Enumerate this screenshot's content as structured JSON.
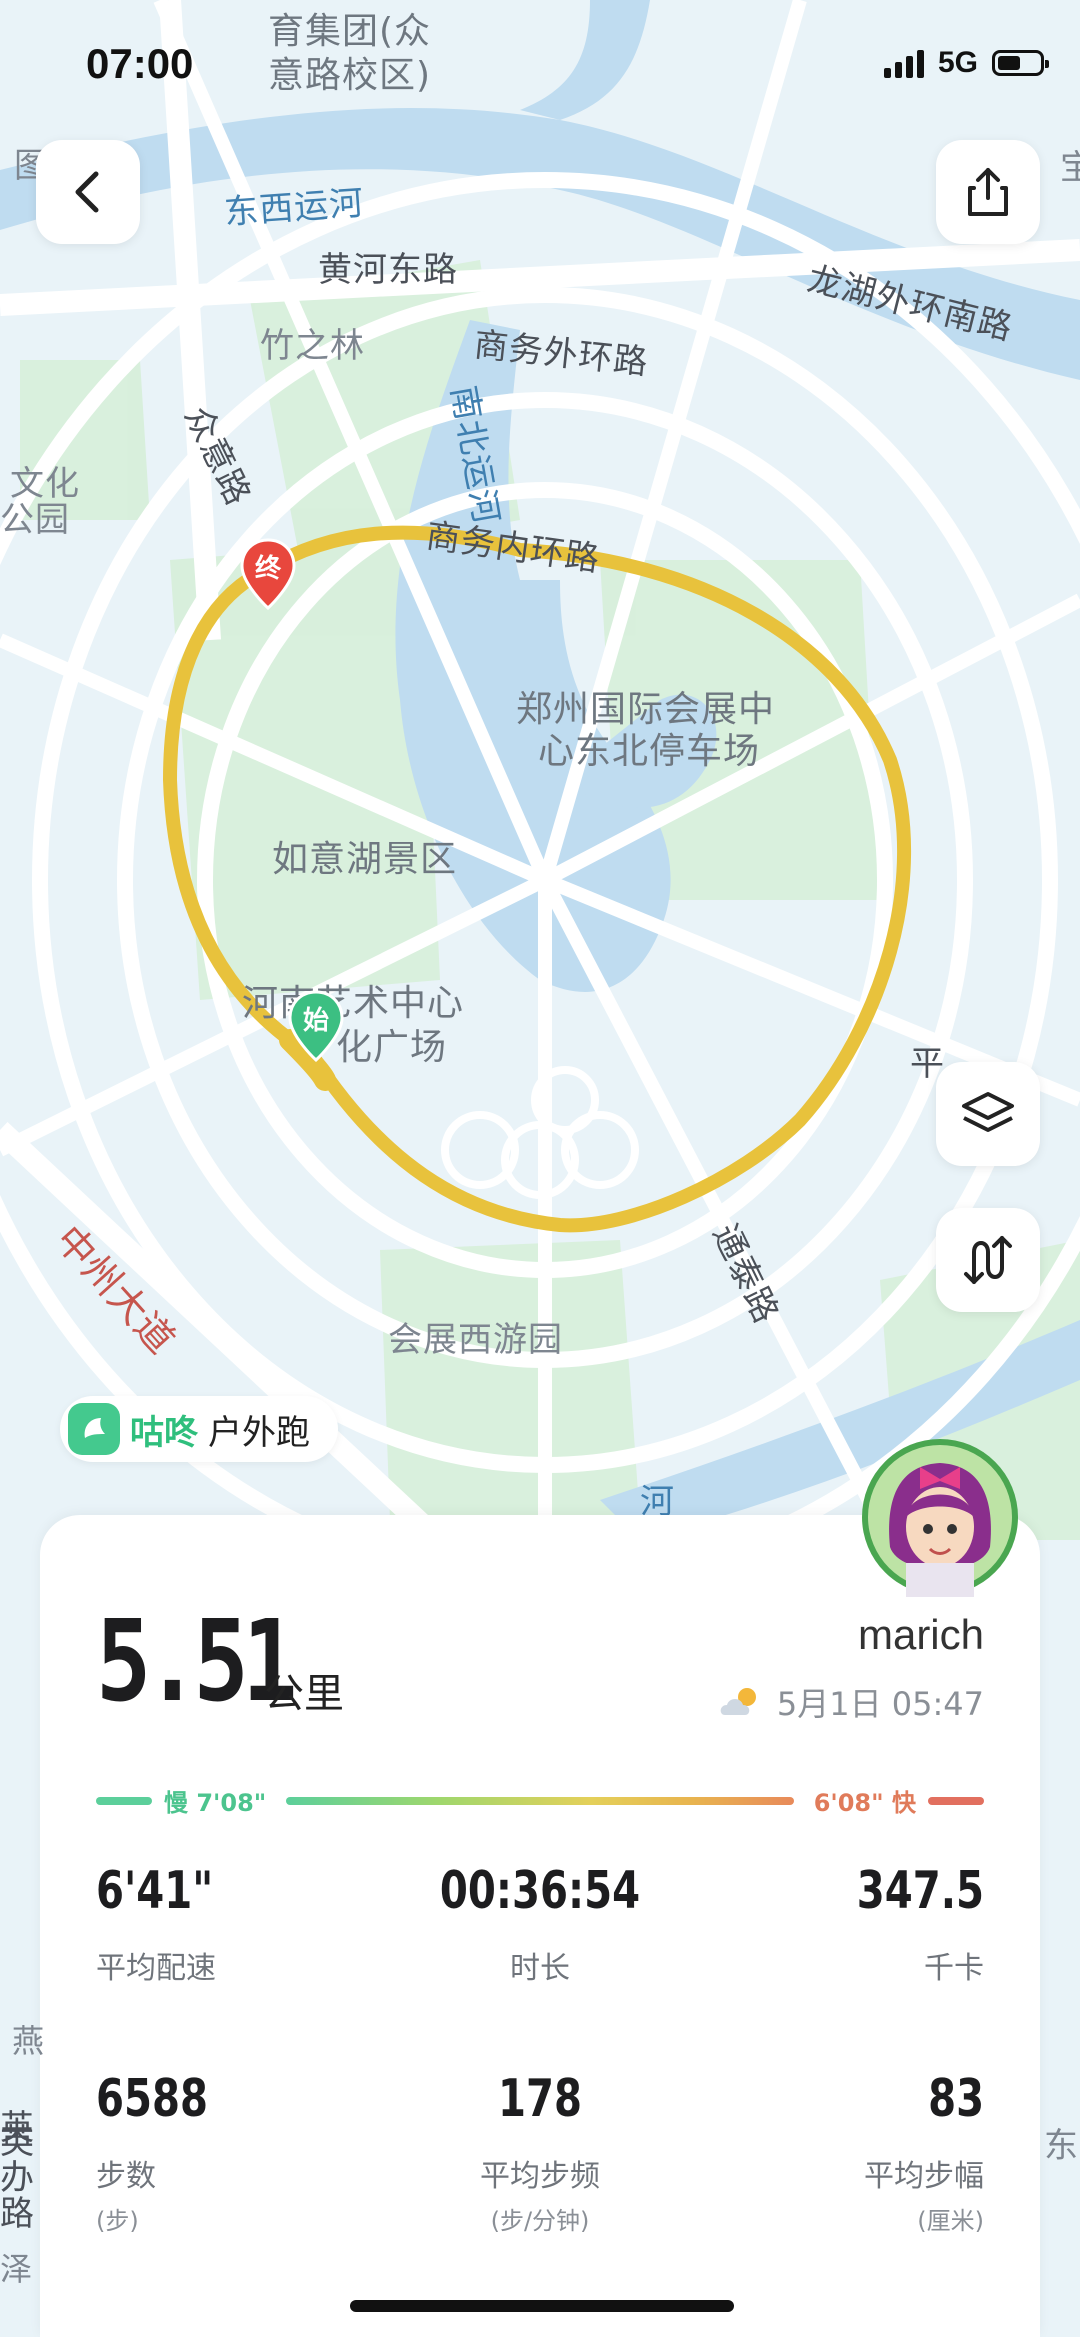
{
  "status_bar": {
    "time": "07:00",
    "network": "5G",
    "battery_level": 0.55
  },
  "map": {
    "labels": {
      "l1": "育集团(众",
      "l2": "意路校区)",
      "l3": "东西运河",
      "l4": "黄河东路",
      "l5": "龙湖外环南路",
      "l6": "竹之林",
      "l7": "商务外环路",
      "l8": "众意路",
      "l9": "南北运河",
      "l10": "商务内环路",
      "l11": "文化",
      "l12": "公园",
      "l13": "郑州国际会展中",
      "l14": "心东北停车场",
      "l15": "如意湖景区",
      "l16": "河南艺术中心",
      "l17": "化广场",
      "l18": "中州大道",
      "l19": "通泰路",
      "l20": "会展西游园",
      "l21": "图",
      "l22": "宝",
      "l23": "河",
      "l24": "平",
      "l25": "英",
      "l26": "办",
      "l27": "路",
      "l28": "东发",
      "l29": "燕",
      "l30": "泽"
    },
    "start_marker": "始",
    "end_marker": "终",
    "route_color": "#e8c23c"
  },
  "controls": {
    "back": "back-icon",
    "share": "share-icon",
    "layers": "layers-icon",
    "route_toggle": "route-toggle-icon"
  },
  "brand": {
    "name": "咕咚",
    "mode": "户外跑"
  },
  "summary": {
    "distance": "5.51",
    "distance_unit": "公里",
    "username": "marich",
    "date": "5月1日 05:47",
    "weather_icon": "partly-cloudy-icon"
  },
  "pace_scale": {
    "slow_label": "慢 7'08\"",
    "fast_label": "6'08\" 快"
  },
  "stats": [
    {
      "value": "6'41\"",
      "label": "平均配速",
      "unit": ""
    },
    {
      "value": "00:36:54",
      "label": "时长",
      "unit": ""
    },
    {
      "value": "347.5",
      "label": "千卡",
      "unit": ""
    },
    {
      "value": "6588",
      "label": "步数",
      "unit": "(步)"
    },
    {
      "value": "178",
      "label": "平均步频",
      "unit": "(步/分钟)"
    },
    {
      "value": "83",
      "label": "平均步幅",
      "unit": "(厘米)"
    }
  ],
  "colors": {
    "accent_green": "#2fbf7d",
    "slow": "#5ccf9b",
    "fast": "#e2705f"
  }
}
